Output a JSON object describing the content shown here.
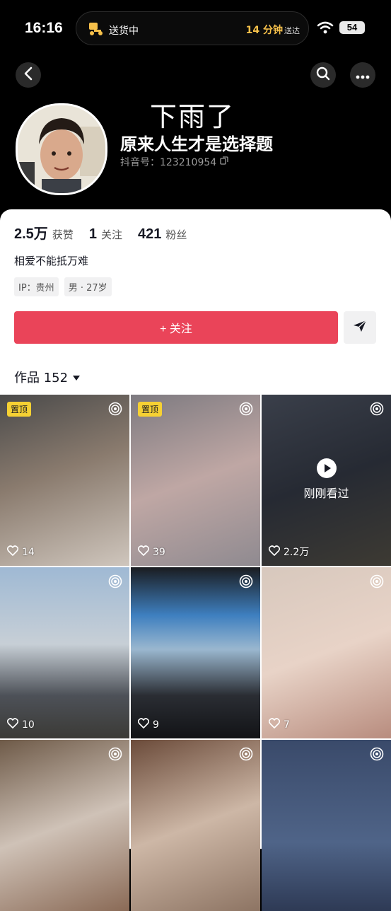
{
  "status_bar": {
    "time": "16:16",
    "island_label": "送货中",
    "island_eta": "14 分钟",
    "island_eta_suffix": "送达",
    "battery": "54"
  },
  "header": {
    "watermark_text": "下雨了",
    "display_name": "原来人生才是选择题",
    "douyin_id": "抖音号：123210954"
  },
  "profile": {
    "stats": [
      {
        "num": "2.5万",
        "label": "获赞"
      },
      {
        "num": "1",
        "label": "关注"
      },
      {
        "num": "421",
        "label": "粉丝"
      }
    ],
    "bio": "相爱不能抵万难",
    "tags": [
      "IP：贵州",
      "男 · 27岁"
    ],
    "follow_label": "+ 关注",
    "works_label": "作品 152"
  },
  "videos": [
    {
      "pinned": "置顶",
      "likes": "14",
      "bg": "linear-gradient(160deg,#4a4a4a 0%,#8a7b6e 45%,#cfc6bd 100%)"
    },
    {
      "pinned": "置顶",
      "likes": "39",
      "bg": "linear-gradient(160deg,#7d7a80 0%,#bfa7a4 50%,#8f8a90 100%)"
    },
    {
      "watched": "刚刚看过",
      "likes": "2.2万",
      "bg": "linear-gradient(160deg,#3a3f4a 0%,#262a33 50%,#3d3a33 100%)"
    },
    {
      "likes": "10",
      "bg": "linear-gradient(180deg,#9fb9d4 0%,#c7cfd6 45%,#4d5158 75%,#3b3a36 100%)"
    },
    {
      "likes": "9",
      "bg": "linear-gradient(180deg,#1a1c20 0%,#3e7fbf 28%,#9ab7cf 48%,#2a2d33 75%,#121316 100%)"
    },
    {
      "likes": "7",
      "bg": "linear-gradient(160deg,#d7c8bd 0%,#e8d3c7 50%,#b88c7e 100%)"
    },
    {
      "likes": "",
      "bg": "linear-gradient(160deg,#6e5a48 0%,#cfc2b7 50%,#8a6a56 100%)"
    },
    {
      "likes": "",
      "bg": "linear-gradient(160deg,#6b4b3a 0%,#cdb7a6 50%,#8d7463 100%)"
    },
    {
      "likes": "",
      "bg": "linear-gradient(180deg,#3a4a6a 0%,#4f6488 60%,#2e3a55 100%)"
    }
  ],
  "colors": {
    "follow_button": "#ea4459",
    "pin_badge": "#f6d133"
  }
}
